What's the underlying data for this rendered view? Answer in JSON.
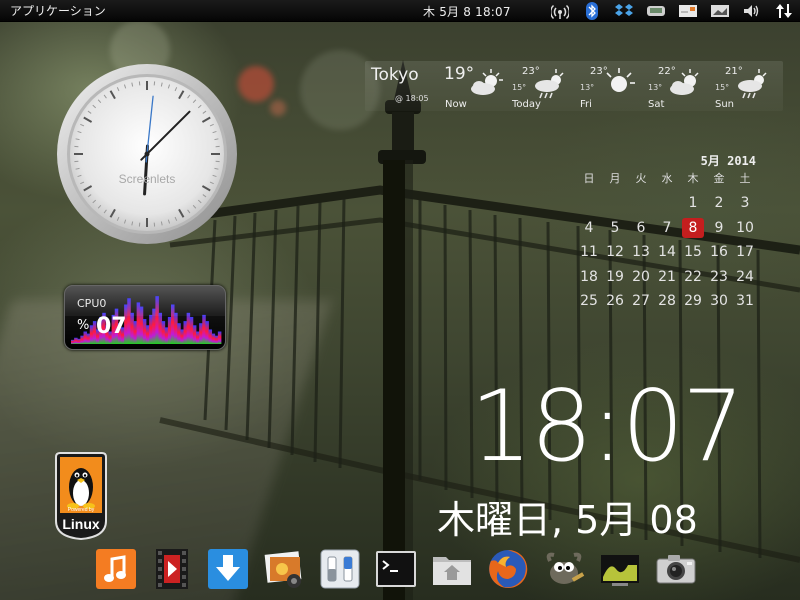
{
  "panel": {
    "apps_menu_label": "アプリケーション",
    "clock_text": "木 5月  8 18:07",
    "tray_icons": [
      "wifi-icon",
      "bluetooth-icon",
      "dropbox-icon",
      "network-icon",
      "mail-icon",
      "display-icon",
      "volume-icon",
      "transfer-icon"
    ]
  },
  "analog_clock": {
    "brand_label": "Screenlets",
    "hour": 18,
    "minute": 7,
    "second": 31
  },
  "weather": {
    "city": "Tokyo",
    "current_temp": "19°",
    "updated": "@ 18:05",
    "days": [
      {
        "name": "Now",
        "high": "",
        "low": "",
        "icon": "partly-cloudy-icon"
      },
      {
        "name": "Today",
        "high": "23°",
        "low": "15°",
        "icon": "rain-icon"
      },
      {
        "name": "Fri",
        "high": "23°",
        "low": "13°",
        "icon": "sunny-icon"
      },
      {
        "name": "Sat",
        "high": "22°",
        "low": "13°",
        "icon": "partly-cloudy-icon"
      },
      {
        "name": "Sun",
        "high": "21°",
        "low": "15°",
        "icon": "rain-icon"
      }
    ]
  },
  "calendar": {
    "title": "5月  2014",
    "weekdays": [
      "日",
      "月",
      "火",
      "水",
      "木",
      "金",
      "土"
    ],
    "weeks": [
      [
        "",
        "",
        "",
        "",
        "1",
        "2",
        "3"
      ],
      [
        "4",
        "5",
        "6",
        "7",
        "8",
        "9",
        "10"
      ],
      [
        "11",
        "12",
        "13",
        "14",
        "15",
        "16",
        "17"
      ],
      [
        "18",
        "19",
        "20",
        "21",
        "22",
        "23",
        "24"
      ],
      [
        "25",
        "26",
        "27",
        "28",
        "29",
        "30",
        "31"
      ]
    ],
    "today": "8",
    "today_color": "#c41e1e"
  },
  "cpu": {
    "label": "CPU0",
    "percent_symbol": "%",
    "value": "07",
    "history": [
      4,
      6,
      5,
      8,
      12,
      10,
      18,
      22,
      14,
      26,
      30,
      18,
      12,
      28,
      34,
      20,
      16,
      38,
      44,
      30,
      22,
      40,
      36,
      24,
      18,
      28,
      34,
      46,
      30,
      22,
      16,
      26,
      38,
      30,
      20,
      14,
      22,
      30,
      26,
      18,
      12,
      20,
      28,
      22,
      14,
      10,
      8,
      12
    ]
  },
  "linux_badge": {
    "powered_by": "Powered by",
    "label": "Linux"
  },
  "big_clock": {
    "time": "18:07",
    "date": "木曜日, 5月 08"
  },
  "dock": {
    "items": [
      {
        "name": "music-player-icon",
        "color": "#f47c22"
      },
      {
        "name": "video-player-icon",
        "color": "#cc2222"
      },
      {
        "name": "download-manager-icon",
        "color": "#2a8ee0"
      },
      {
        "name": "image-viewer-icon",
        "color": "#d87a2a"
      },
      {
        "name": "settings-toggle-icon",
        "color": "#d8dde2"
      },
      {
        "name": "terminal-icon",
        "color": "#111111"
      },
      {
        "name": "home-folder-icon",
        "color": "#d9d9d9"
      },
      {
        "name": "firefox-icon",
        "color": "#e8671a"
      },
      {
        "name": "gimp-icon",
        "color": "#6e6a5c"
      },
      {
        "name": "system-monitor-icon",
        "color": "#b7c33a"
      },
      {
        "name": "camera-icon",
        "color": "#cfcfcf"
      }
    ]
  },
  "colors": {
    "panel_bg": "#0a0a0a",
    "cpu_graph_blue": "#3a3aff",
    "cpu_graph_red": "#ff1a3c",
    "cpu_graph_green": "#1fd01f"
  }
}
